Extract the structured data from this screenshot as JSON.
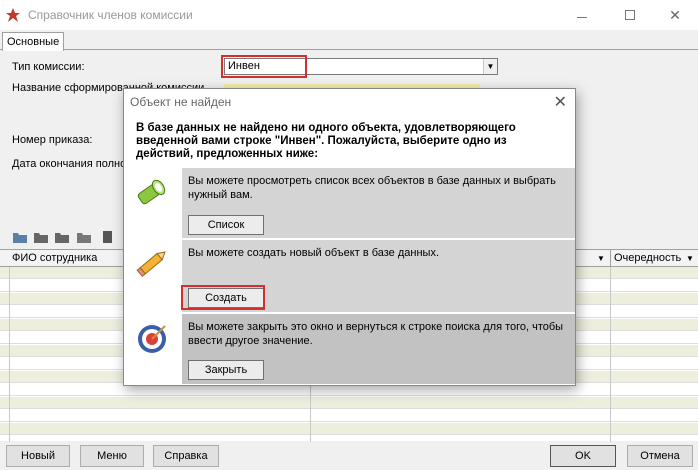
{
  "window": {
    "title": "Справочник членов комиссии"
  },
  "tabs": [
    {
      "label": "Основные"
    }
  ],
  "form": {
    "commission_type_label": "Тип комиссии:",
    "commission_type_value": "Инвен",
    "formed_name_label": "Название сформированной комиссии",
    "order_number_label": "Номер приказа:",
    "end_date_label": "Дата окончания полно"
  },
  "grid": {
    "columns": [
      "ФИО сотрудника",
      "Очередность"
    ]
  },
  "bottom_buttons": {
    "new": "Новый",
    "menu": "Меню",
    "help": "Справка",
    "ok": "OK",
    "cancel": "Отмена"
  },
  "dialog": {
    "title": "Объект не найден",
    "message": "В базе данных не найдено ни одного объекта, удовлетворяющего введенной вами строке \"Инвен\". Пожалуйста, выберите одно из действий, предложенных ниже:",
    "options": [
      {
        "text": "Вы можете просмотреть список всех объектов в базе данных и выбрать нужный вам.",
        "button": "Список",
        "icon": "flashlight-icon"
      },
      {
        "text": "Вы можете создать новый объект в базе данных.",
        "button": "Создать",
        "icon": "pencil-icon"
      },
      {
        "text": "Вы можете закрыть это окно и вернуться к строке поиска для того, чтобы ввести другое значение.",
        "button": "Закрыть",
        "icon": "target-icon"
      }
    ]
  },
  "colors": {
    "highlight": "#d32f2f",
    "grid_alt_row": "#eeeedd",
    "yellow_field": "#f2eea8"
  }
}
